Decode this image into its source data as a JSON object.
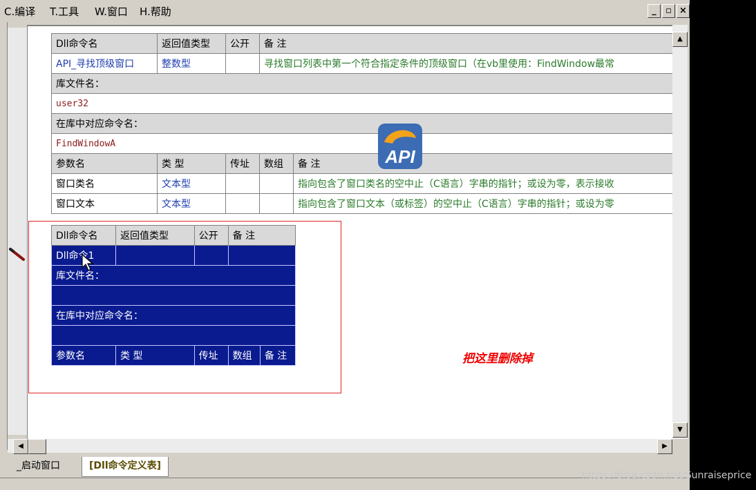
{
  "menu": {
    "compile": "C.编译",
    "tools": "T.工具",
    "window": "W.窗口",
    "help": "H.帮助"
  },
  "window_buttons": {
    "minimize": "_",
    "restore": "▫",
    "close": "×"
  },
  "dll_table": {
    "headers": [
      "Dll命令名",
      "返回值类型",
      "公开",
      "备 注"
    ],
    "name": "API_寻找顶级窗口",
    "return_type": "整数型",
    "public": "",
    "note": "寻找窗口列表中第一个符合指定条件的顶级窗口（在vb里使用：FindWindow最常",
    "lib_label": "库文件名：",
    "lib_value": "user32",
    "cmd_label": "在库中对应命令名：",
    "cmd_value": "FindWindowA",
    "param_headers": [
      "参数名",
      "类 型",
      "传址",
      "数组",
      "备 注"
    ],
    "params": [
      {
        "name": "窗口类名",
        "type": "文本型",
        "byref": "",
        "array": "",
        "note": "指向包含了窗口类名的空中止（C语言）字串的指针；或设为零，表示接收"
      },
      {
        "name": "窗口文本",
        "type": "文本型",
        "byref": "",
        "array": "",
        "note": "指向包含了窗口文本（或标签）的空中止（C语言）字串的指针；或设为零"
      }
    ]
  },
  "sel_table": {
    "headers": [
      "Dll命令名",
      "返回值类型",
      "公开",
      "备 注"
    ],
    "name": "Dll命令1",
    "lib_label": "库文件名：",
    "cmd_label": "在库中对应命令名：",
    "param_headers": [
      "参数名",
      "类 型",
      "传址",
      "数组",
      "备 注"
    ]
  },
  "annotation": "把这里删除掉",
  "tabs": {
    "startup": "_启动窗口",
    "dll_defs": "[Dll命令定义表]"
  },
  "watermark": "https://blog.csdn.net/Sunraiseprice",
  "colors": {
    "selection": "#0a1a8f",
    "annotation_red": "#e00000",
    "type_blue": "#1f3fae",
    "note_green": "#2a7a2a"
  }
}
